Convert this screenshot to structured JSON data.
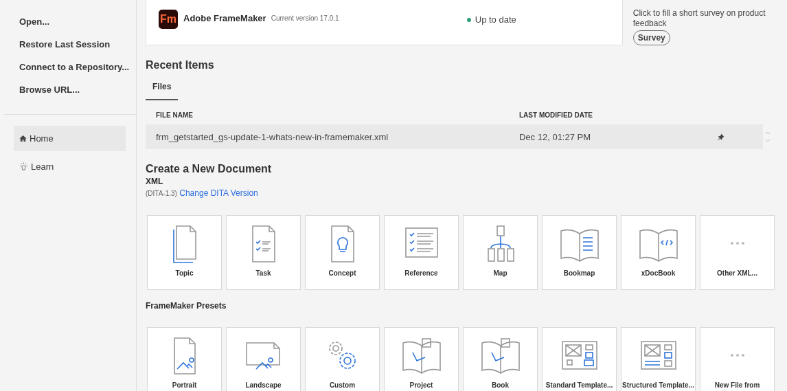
{
  "sidebar": {
    "actions": [
      {
        "label": "Open..."
      },
      {
        "label": "Restore Last Session"
      },
      {
        "label": "Connect to a Repository..."
      },
      {
        "label": "Browse URL..."
      }
    ],
    "nav": [
      {
        "label": "Home",
        "kind": "home",
        "selected": true
      },
      {
        "label": "Learn",
        "kind": "bulb",
        "selected": false
      }
    ]
  },
  "product": {
    "logo": "Fm",
    "name": "Adobe FrameMaker",
    "version": "Current version 17.0.1",
    "status": "Up to date"
  },
  "survey": {
    "text": "Click to fill a short survey on product feedback",
    "button": "Survey"
  },
  "recent": {
    "title": "Recent Items",
    "tabs": [
      {
        "label": "Files",
        "selected": true
      }
    ],
    "columns": [
      "FILE NAME",
      "LAST MODIFIED DATE"
    ],
    "rows": [
      {
        "name": "frm_getstarted_gs-update-1-whats-new-in-framemaker.xml",
        "date": "Dec 12, 01:27 PM"
      }
    ]
  },
  "create": {
    "title": "Create a New Document",
    "subtitle": "XML",
    "dita": "(DITA-1.3)",
    "link": "Change DITA Version",
    "xml_tiles": [
      {
        "label": "Topic",
        "kind": "topic"
      },
      {
        "label": "Task",
        "kind": "task"
      },
      {
        "label": "Concept",
        "kind": "concept"
      },
      {
        "label": "Reference",
        "kind": "reference"
      },
      {
        "label": "Map",
        "kind": "map"
      },
      {
        "label": "Bookmap",
        "kind": "bookmap"
      },
      {
        "label": "xDocBook",
        "kind": "xdocbook"
      },
      {
        "label": "Other XML...",
        "kind": "more"
      }
    ],
    "presets_title": "FrameMaker Presets",
    "preset_tiles": [
      {
        "label": "Portrait",
        "kind": "portrait"
      },
      {
        "label": "Landscape",
        "kind": "landscape"
      },
      {
        "label": "Custom",
        "kind": "custom"
      },
      {
        "label": "Project",
        "kind": "book"
      },
      {
        "label": "Book",
        "kind": "book"
      },
      {
        "label": "Standard Template...",
        "kind": "standard"
      },
      {
        "label": "Structured Template...",
        "kind": "structured"
      },
      {
        "label": "New File from",
        "kind": "more"
      }
    ]
  }
}
